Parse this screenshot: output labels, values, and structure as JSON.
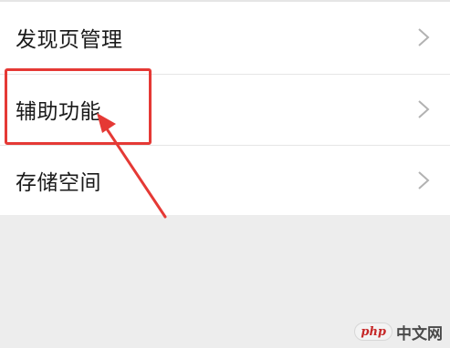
{
  "settings": {
    "items": [
      {
        "label": "发现页管理"
      },
      {
        "label": "辅助功能"
      },
      {
        "label": "存储空间"
      }
    ]
  },
  "annotation": {
    "color": "#e53935",
    "highlighted_item": "辅助功能"
  },
  "watermark": {
    "logo": "php",
    "text": "中文网"
  },
  "colors": {
    "background": "#ededed",
    "list_background": "#ffffff",
    "text": "#1a1a1a",
    "chevron": "#b2b2b2",
    "annotation": "#e53935"
  },
  "icons": [
    "chevron-right-icon"
  ]
}
